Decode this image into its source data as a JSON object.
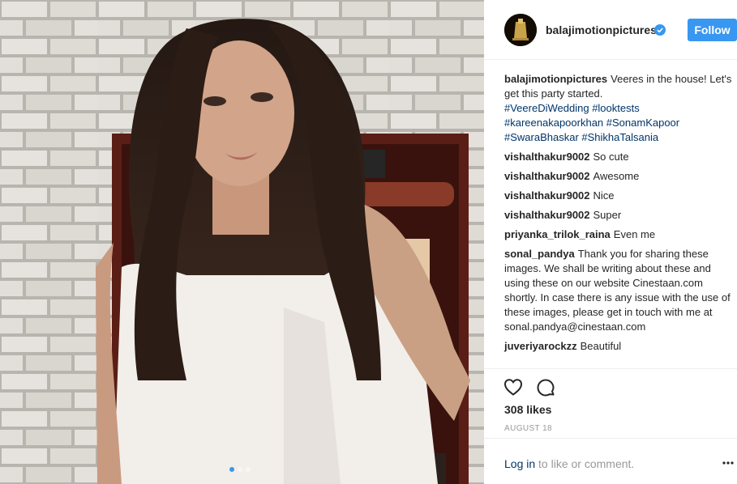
{
  "header": {
    "username": "balajimotionpictures",
    "follow_label": "Follow",
    "verified_icon": "verified-badge-icon"
  },
  "caption": {
    "username": "balajimotionpictures",
    "text": "Veeres in the house! Let's get this party started.",
    "hashtags": [
      "#VeereDiWedding",
      "#looktests",
      "#kareenakapoorkhan",
      "#SonamKapoor",
      "#SwaraBhaskar",
      "#ShikhaTalsania"
    ]
  },
  "comments": [
    {
      "user": "vishalthakur9002",
      "text": "So cute"
    },
    {
      "user": "vishalthakur9002",
      "text": "Awesome"
    },
    {
      "user": "vishalthakur9002",
      "text": "Nice"
    },
    {
      "user": "vishalthakur9002",
      "text": "Super"
    },
    {
      "user": "priyanka_trilok_raina",
      "text": "Even me"
    },
    {
      "user": "sonal_pandya",
      "text": "Thank you for sharing these images. We shall be writing about these and using these on our website Cinestaan.com shortly. In case there is any issue with the use of these images, please get in touch with me at sonal.pandya@cinestaan.com"
    },
    {
      "user": "juveriyarockzz",
      "text": "Beautiful"
    }
  ],
  "actions": {
    "like_icon": "heart-icon",
    "comment_icon": "comment-bubble-icon"
  },
  "likes": "308 likes",
  "date": "AUGUST 18",
  "footer": {
    "login_link": "Log in",
    "login_suffix": " to like or comment.",
    "more_icon": "more-options-icon"
  },
  "carousel": {
    "total": 3,
    "active": 1
  },
  "colors": {
    "accent": "#3897f0",
    "link": "#003569",
    "muted": "#999999"
  }
}
